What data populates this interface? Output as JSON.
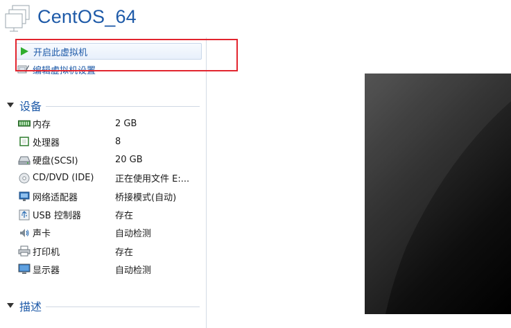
{
  "vm": {
    "title": "CentOS_64"
  },
  "actions": {
    "start_label": "开启此虚拟机",
    "edit_label": "编辑虚拟机设置"
  },
  "devices_section": {
    "title": "设备"
  },
  "devices": [
    {
      "icon": "memory-icon",
      "name": "内存",
      "value": "2 GB"
    },
    {
      "icon": "processor-icon",
      "name": "处理器",
      "value": "8"
    },
    {
      "icon": "hard-disk-icon",
      "name": "硬盘(SCSI)",
      "value": "20 GB"
    },
    {
      "icon": "cd-dvd-icon",
      "name": "CD/DVD (IDE)",
      "value": "正在使用文件 E:..."
    },
    {
      "icon": "network-adapter-icon",
      "name": "网络适配器",
      "value": "桥接模式(自动)"
    },
    {
      "icon": "usb-icon",
      "name": "USB 控制器",
      "value": "存在"
    },
    {
      "icon": "sound-card-icon",
      "name": "声卡",
      "value": "自动检测"
    },
    {
      "icon": "printer-icon",
      "name": "打印机",
      "value": "存在"
    },
    {
      "icon": "display-icon",
      "name": "显示器",
      "value": "自动检测"
    }
  ],
  "description_section": {
    "title": "描述"
  },
  "colors": {
    "accent": "#1e5aa8",
    "highlight": "#e2242e",
    "play": "#2fae2f"
  }
}
